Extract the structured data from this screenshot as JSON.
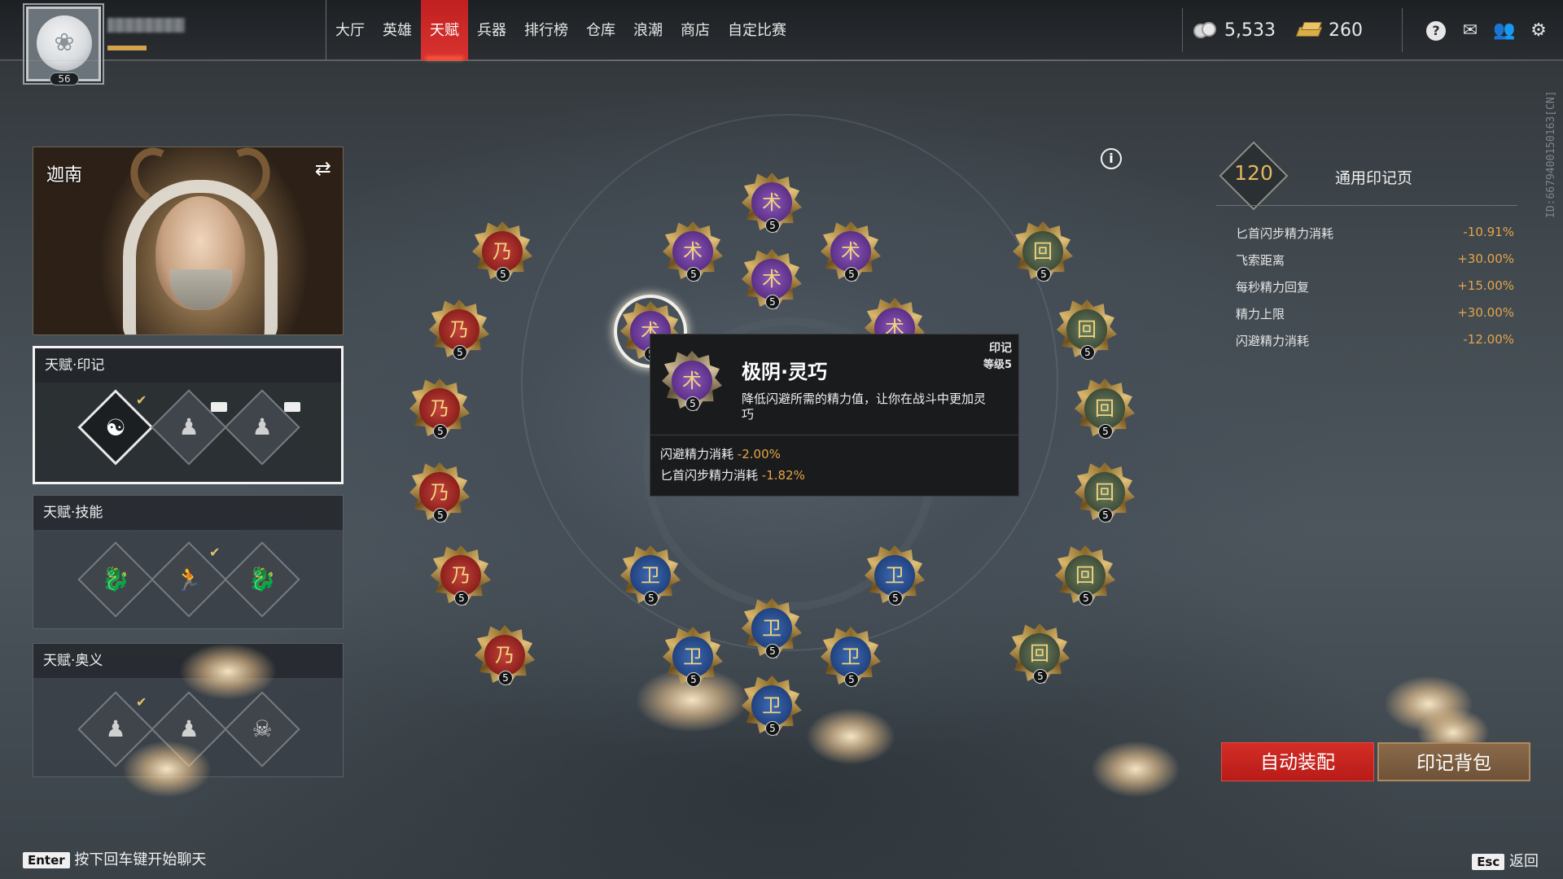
{
  "player": {
    "level": "56"
  },
  "nav": {
    "items": [
      "大厅",
      "英雄",
      "天赋",
      "兵器",
      "排行榜",
      "仓库",
      "浪潮",
      "商店",
      "自定比赛"
    ],
    "active_index": 2
  },
  "currency": {
    "coins": "5,533",
    "gold": "260"
  },
  "top_icons": [
    "help-icon",
    "mail-icon",
    "friends-icon",
    "settings-icon"
  ],
  "side_id": "ID:6679400150163[CN]",
  "hero": {
    "name": "迦南"
  },
  "panels": {
    "seal": {
      "title": "天赋·印记"
    },
    "skill": {
      "title": "天赋·技能"
    },
    "ultimate": {
      "title": "天赋·奥义"
    }
  },
  "wheel": {
    "nodes": [
      {
        "color": "red",
        "glyph": "乃",
        "level": "5"
      },
      {
        "color": "red",
        "glyph": "乃",
        "level": "5"
      },
      {
        "color": "red",
        "glyph": "乃",
        "level": "5"
      },
      {
        "color": "red",
        "glyph": "乃",
        "level": "5"
      },
      {
        "color": "red",
        "glyph": "乃",
        "level": "5"
      },
      {
        "color": "red",
        "glyph": "乃",
        "level": "5"
      },
      {
        "color": "purple",
        "glyph": "术",
        "level": "5"
      },
      {
        "color": "purple",
        "glyph": "术",
        "level": "5"
      },
      {
        "color": "purple",
        "glyph": "术",
        "level": "5"
      },
      {
        "color": "purple",
        "glyph": "术",
        "level": "5"
      },
      {
        "color": "purple",
        "glyph": "术",
        "level": "5"
      },
      {
        "color": "purple",
        "glyph": "术",
        "level": "5"
      },
      {
        "color": "green",
        "glyph": "回",
        "level": "5"
      },
      {
        "color": "green",
        "glyph": "回",
        "level": "5"
      },
      {
        "color": "green",
        "glyph": "回",
        "level": "5"
      },
      {
        "color": "green",
        "glyph": "回",
        "level": "5"
      },
      {
        "color": "green",
        "glyph": "回",
        "level": "5"
      },
      {
        "color": "green",
        "glyph": "回",
        "level": "5"
      },
      {
        "color": "blue",
        "glyph": "卫",
        "level": "5"
      },
      {
        "color": "blue",
        "glyph": "卫",
        "level": "5"
      },
      {
        "color": "blue",
        "glyph": "卫",
        "level": "5"
      },
      {
        "color": "blue",
        "glyph": "卫",
        "level": "5"
      },
      {
        "color": "blue",
        "glyph": "卫",
        "level": "5"
      },
      {
        "color": "blue",
        "glyph": "卫",
        "level": "5"
      }
    ]
  },
  "tooltip": {
    "type": "印记",
    "level": "等级5",
    "name": "极阴·灵巧",
    "desc": "降低闪避所需的精力值，让你在战斗中更加灵巧",
    "icon_level": "5",
    "stats": [
      {
        "label": "闪避精力消耗",
        "value": "-2.00%"
      },
      {
        "label": "匕首闪步精力消耗",
        "value": "-1.82%"
      }
    ]
  },
  "right": {
    "points": "120",
    "page_title": "通用印记页",
    "stats": [
      {
        "label": "匕首闪步精力消耗",
        "value": "-10.91%"
      },
      {
        "label": "飞索距离",
        "value": "+30.00%"
      },
      {
        "label": "每秒精力回复",
        "value": "+15.00%"
      },
      {
        "label": "精力上限",
        "value": "+30.00%"
      },
      {
        "label": "闪避精力消耗",
        "value": "-12.00%"
      }
    ]
  },
  "buttons": {
    "auto": "自动装配",
    "bag": "印记背包"
  },
  "footer": {
    "enter_key": "Enter",
    "enter_text": "按下回车键开始聊天",
    "esc_key": "Esc",
    "esc_text": "返回"
  },
  "colors": {
    "accent_red": "#d42d26",
    "stat_value": "#e4a548",
    "points": "#e4b85a"
  }
}
